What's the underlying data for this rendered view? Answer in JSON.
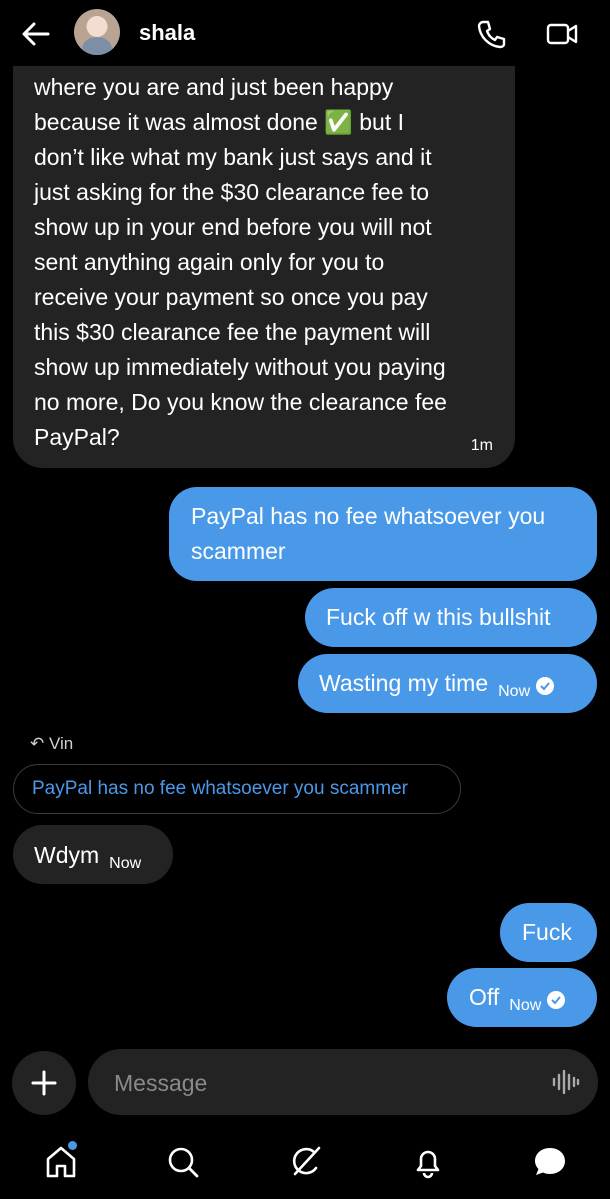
{
  "header": {
    "contact_name": "shala"
  },
  "messages": [
    {
      "direction": "incoming",
      "lines": [
        "where you are and just been happy",
        "because it was almost done ✅ but I",
        "don’t like what my bank just says and it",
        "just asking for the $30 clearance fee to",
        "show up in your end before you will not",
        "sent anything again only for you to",
        "receive your payment so once you pay",
        "this $30 clearance fee the payment will",
        "show up immediately without you paying",
        "no more, Do you know the clearance fee",
        "PayPal?"
      ],
      "time": "1m"
    },
    {
      "direction": "outgoing",
      "lines": [
        "PayPal has no fee whatsoever you",
        "scammer"
      ]
    },
    {
      "direction": "outgoing",
      "text": "Fuck off w this bullshit"
    },
    {
      "direction": "outgoing",
      "text": "Wasting my time",
      "time": "Now"
    },
    {
      "direction": "incoming",
      "text": "Wdym",
      "time": "Now"
    },
    {
      "direction": "outgoing",
      "text": "Fuck"
    },
    {
      "direction": "outgoing",
      "text": "Off",
      "time": "Now"
    }
  ],
  "reply": {
    "label": "Vin",
    "quoted_text": "PayPal has no fee whatsoever you scammer"
  },
  "composer": {
    "placeholder": "Message"
  },
  "nav": [
    "home-icon",
    "search-icon",
    "grok-icon",
    "notifications-icon",
    "messages-icon"
  ],
  "colors": {
    "accent": "#4a99e9",
    "bubble_in": "#232323",
    "background": "#000000"
  }
}
